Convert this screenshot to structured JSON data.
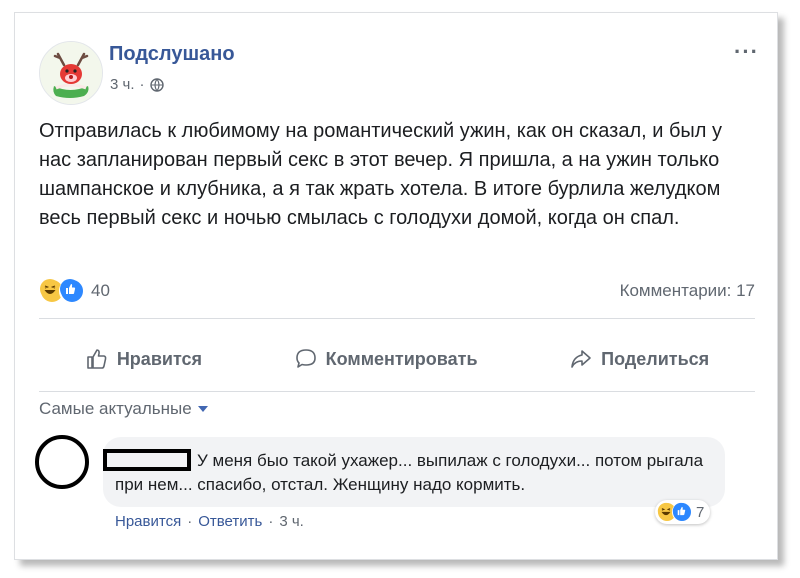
{
  "post": {
    "page_name": "Подслушано",
    "time": "3 ч.",
    "separator": "·",
    "more_label": "···",
    "text": "Отправилась к любимому на романтический ужин, как он сказал, и был у нас запланирован первый секс в этот вечер. Я пришла, а на ужин только шампанское и клубника, а я так жрать хотела. В итоге бурлила желудком весь первый секс и ночью смылась с голодухи домой, когда он спал.",
    "reactions_count": "40",
    "comments_label": "Комментарии: 17"
  },
  "actions": {
    "like": "Нравится",
    "comment": "Комментировать",
    "share": "Поделиться"
  },
  "comments": {
    "sort_label": "Самые актуальные",
    "items": [
      {
        "text": "У меня быо такой ухажер... выпилаж с голодухи... потом рыгала при нем... спасибо, отстал. Женщину надо кормить.",
        "reactions_count": "7",
        "like_label": "Нравится",
        "reply_label": "Ответить",
        "time": "3 ч.",
        "dot": "·"
      }
    ]
  },
  "colors": {
    "link_blue": "#385898",
    "like_blue": "#2d88ff",
    "haha_yellow": "#f7c744",
    "muted": "#606770"
  },
  "icons": [
    "reindeer-avatar",
    "globe-icon",
    "more-icon",
    "haha-icon",
    "like-icon",
    "thumb-up-icon",
    "comment-icon",
    "share-icon",
    "caret-down-icon"
  ]
}
